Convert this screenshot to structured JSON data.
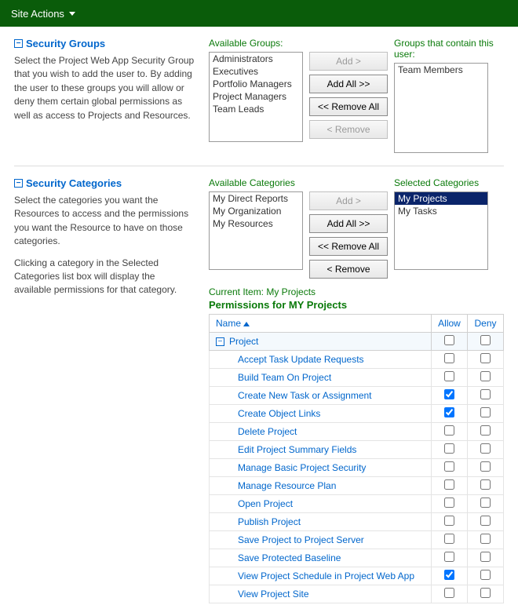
{
  "ribbon": {
    "site_actions": "Site Actions"
  },
  "sections": {
    "groups": {
      "title": "Security Groups",
      "desc": "Select the Project Web App Security Group that you wish to add the user to. By adding the user to these groups you will allow or deny them certain global permissions as well as access to Projects and Resources.",
      "available_label": "Available Groups:",
      "contain_label": "Groups that contain this user:",
      "available": [
        "Administrators",
        "Executives",
        "Portfolio Managers",
        "Project Managers",
        "Team Leads"
      ],
      "contain": [
        "Team Members"
      ],
      "buttons": {
        "add": "Add >",
        "add_all": "Add All >>",
        "remove_all": "<< Remove All",
        "remove": "< Remove"
      }
    },
    "categories": {
      "title": "Security Categories",
      "desc1": "Select the categories you want the Resources to access and the permissions you want the Resource to have on those categories.",
      "desc2": "Clicking a category in the Selected Categories list box will display the available permissions for that category.",
      "available_label": "Available Categories",
      "selected_label": "Selected Categories",
      "available": [
        "My Direct Reports",
        "My Organization",
        "My Resources"
      ],
      "selected": [
        "My Projects",
        "My Tasks"
      ],
      "selected_index": 0,
      "buttons": {
        "add": "Add >",
        "add_all": "Add All >>",
        "remove_all": "<< Remove All",
        "remove": "< Remove"
      },
      "current_item_label": "Current Item: My Projects",
      "perm_title": "Permissions for MY Projects",
      "perm_columns": {
        "name": "Name",
        "allow": "Allow",
        "deny": "Deny"
      },
      "perm_group": "Project",
      "perms": [
        {
          "name": "Accept Task Update Requests",
          "allow": false,
          "deny": false
        },
        {
          "name": "Build Team On Project",
          "allow": false,
          "deny": false
        },
        {
          "name": "Create New Task or Assignment",
          "allow": true,
          "deny": false
        },
        {
          "name": "Create Object Links",
          "allow": true,
          "deny": false
        },
        {
          "name": "Delete Project",
          "allow": false,
          "deny": false
        },
        {
          "name": "Edit Project Summary Fields",
          "allow": false,
          "deny": false
        },
        {
          "name": "Manage Basic Project Security",
          "allow": false,
          "deny": false
        },
        {
          "name": "Manage Resource Plan",
          "allow": false,
          "deny": false
        },
        {
          "name": "Open Project",
          "allow": false,
          "deny": false
        },
        {
          "name": "Publish Project",
          "allow": false,
          "deny": false
        },
        {
          "name": "Save Project to Project Server",
          "allow": false,
          "deny": false
        },
        {
          "name": "Save Protected Baseline",
          "allow": false,
          "deny": false
        },
        {
          "name": "View Project Schedule in Project Web App",
          "allow": true,
          "deny": false
        },
        {
          "name": "View Project Site",
          "allow": false,
          "deny": false
        }
      ]
    }
  }
}
